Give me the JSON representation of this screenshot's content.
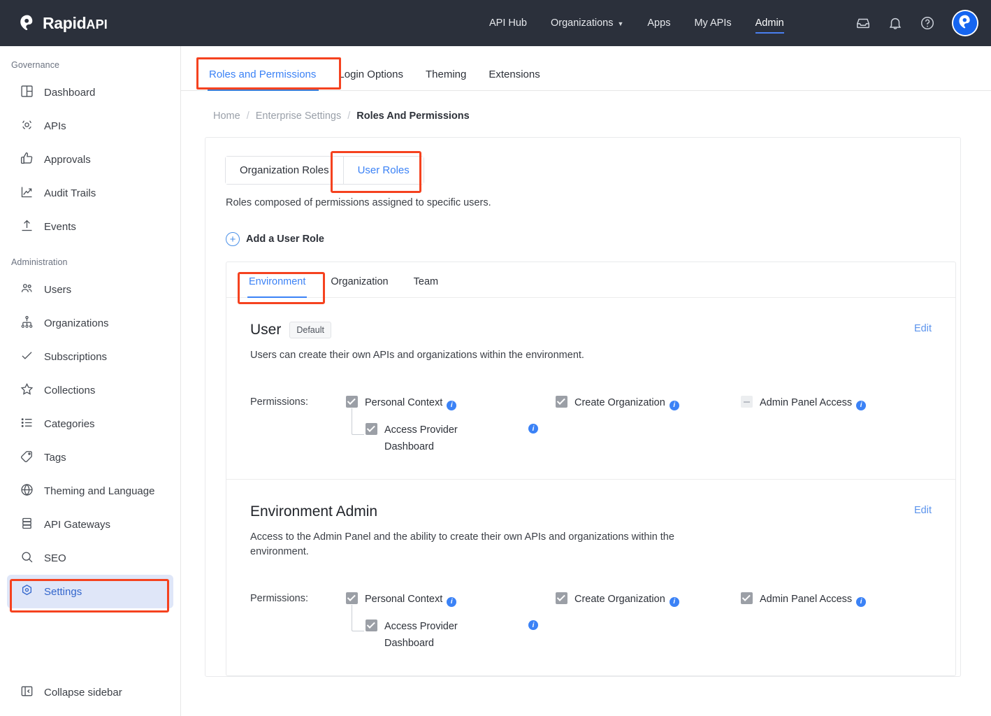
{
  "header": {
    "brand_name": "Rapid",
    "brand_suffix": "API",
    "nav": [
      {
        "label": "API Hub",
        "active": false,
        "caret": false
      },
      {
        "label": "Organizations",
        "active": false,
        "caret": true
      },
      {
        "label": "Apps",
        "active": false,
        "caret": false
      },
      {
        "label": "My APIs",
        "active": false,
        "caret": false
      },
      {
        "label": "Admin",
        "active": true,
        "caret": false
      }
    ],
    "icons": [
      "inbox-icon",
      "bell-icon",
      "help-icon",
      "avatar"
    ]
  },
  "sidebar": {
    "groups": [
      {
        "label": "Governance",
        "items": [
          {
            "label": "Dashboard",
            "icon": "dashboard-icon"
          },
          {
            "label": "APIs",
            "icon": "apis-icon"
          },
          {
            "label": "Approvals",
            "icon": "thumbs-up-icon"
          },
          {
            "label": "Audit Trails",
            "icon": "trending-up-icon"
          },
          {
            "label": "Events",
            "icon": "upload-icon"
          }
        ]
      },
      {
        "label": "Administration",
        "items": [
          {
            "label": "Users",
            "icon": "users-icon"
          },
          {
            "label": "Organizations",
            "icon": "org-tree-icon"
          },
          {
            "label": "Subscriptions",
            "icon": "check-icon"
          },
          {
            "label": "Collections",
            "icon": "star-icon"
          },
          {
            "label": "Categories",
            "icon": "list-icon"
          },
          {
            "label": "Tags",
            "icon": "tag-icon"
          },
          {
            "label": "Theming and Language",
            "icon": "globe-icon"
          },
          {
            "label": "API Gateways",
            "icon": "database-icon"
          },
          {
            "label": "SEO",
            "icon": "search-icon"
          },
          {
            "label": "Settings",
            "icon": "settings-icon",
            "active": true
          }
        ]
      }
    ],
    "collapse_label": "Collapse sidebar"
  },
  "tabs": [
    {
      "label": "Roles and Permissions",
      "active": true
    },
    {
      "label": "Login Options",
      "active": false
    },
    {
      "label": "Theming",
      "active": false
    },
    {
      "label": "Extensions",
      "active": false
    }
  ],
  "breadcrumb": [
    {
      "label": "Home",
      "current": false
    },
    {
      "label": "Enterprise Settings",
      "current": false
    },
    {
      "label": "Roles And Permissions",
      "current": true
    }
  ],
  "segmented": [
    {
      "label": "Organization Roles",
      "active": false
    },
    {
      "label": "User Roles",
      "active": true
    }
  ],
  "card_subtitle": "Roles composed of permissions assigned to specific users.",
  "add_role_label": "Add a User Role",
  "inner_tabs": [
    {
      "label": "Environment",
      "active": true
    },
    {
      "label": "Organization",
      "active": false
    },
    {
      "label": "Team",
      "active": false
    }
  ],
  "roles": [
    {
      "name": "User",
      "badge": "Default",
      "description": "Users can create their own APIs and organizations within the environment.",
      "edit_label": "Edit",
      "permissions_label": "Permissions:",
      "permissions": [
        {
          "label": "Personal Context",
          "state": "checked",
          "info": true
        },
        {
          "label": "Create Organization",
          "state": "checked",
          "info": true
        },
        {
          "label": "Admin Panel Access",
          "state": "indeterminate",
          "info": true
        }
      ],
      "sub_permission": {
        "label": "Access Provider Dashboard",
        "state": "checked",
        "info": true
      }
    },
    {
      "name": "Environment Admin",
      "badge": "",
      "description": "Access to the Admin Panel and the ability to create their own APIs and organizations within the environment.",
      "edit_label": "Edit",
      "permissions_label": "Permissions:",
      "permissions": [
        {
          "label": "Personal Context",
          "state": "checked",
          "info": true
        },
        {
          "label": "Create Organization",
          "state": "checked",
          "info": true
        },
        {
          "label": "Admin Panel Access",
          "state": "checked",
          "info": true
        }
      ],
      "sub_permission": {
        "label": "Access Provider Dashboard",
        "state": "checked",
        "info": true
      }
    }
  ],
  "colors": {
    "topbar_bg": "#2b303b",
    "accent_blue": "#3b82f6",
    "highlight_red": "#f5421f",
    "sidebar_active_bg": "#dfe6f8",
    "checkbox_grey": "#9b9fa6"
  }
}
